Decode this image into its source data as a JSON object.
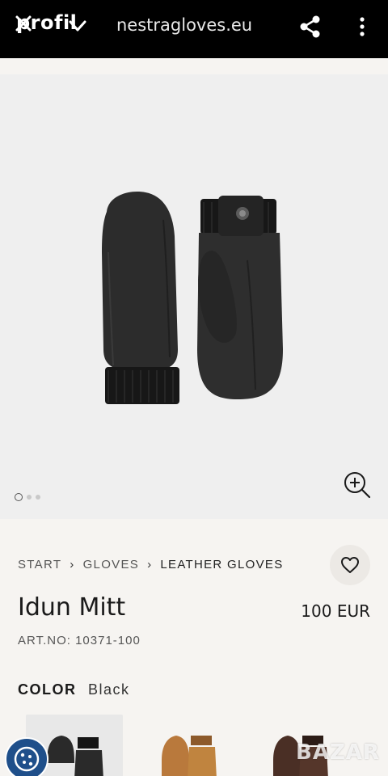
{
  "browser": {
    "brand": "profil",
    "url": "nestragloves.eu"
  },
  "gallery": {
    "dots_total": 3,
    "active_index": 0
  },
  "breadcrumb": {
    "items": [
      "START",
      "GLOVES",
      "LEATHER GLOVES"
    ]
  },
  "product": {
    "name": "Idun Mitt",
    "price": "100 EUR",
    "art_no": "ART.NO: 10371-100",
    "color_label": "COLOR",
    "color_value": "Black"
  },
  "swatches": [
    {
      "name": "black",
      "color": "#2a2a2a"
    },
    {
      "name": "cork",
      "color": "#b9793c"
    },
    {
      "name": "brown",
      "color": "#4a2f25"
    }
  ],
  "watermark": "BAZAR"
}
